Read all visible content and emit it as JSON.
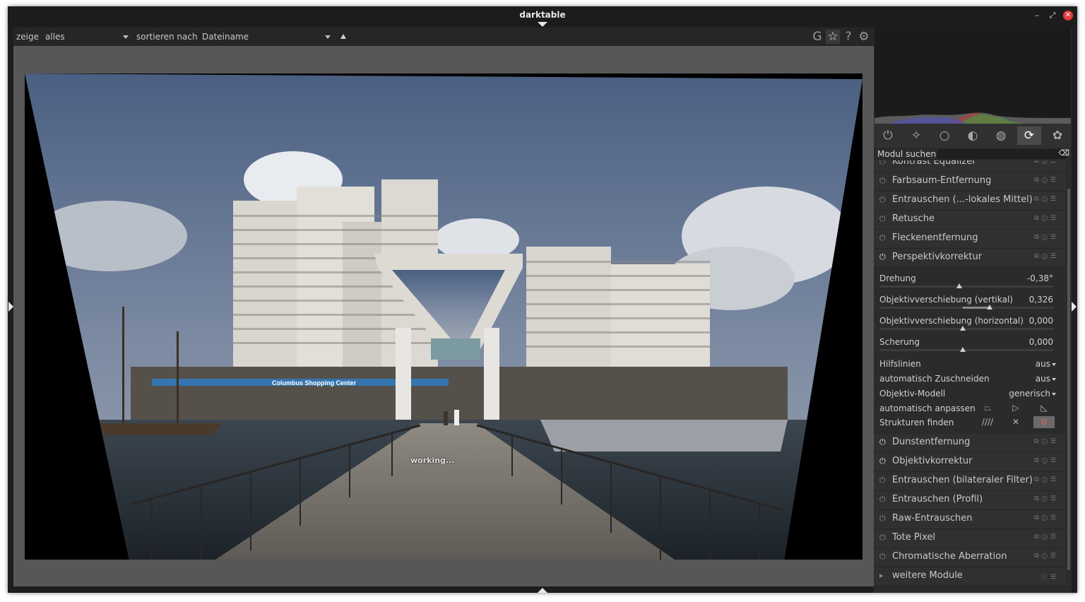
{
  "window": {
    "title": "darktable",
    "controls": [
      "–",
      "⤢",
      "✕"
    ]
  },
  "toolbar": {
    "show_label": "zeige",
    "show_value": "alles",
    "sort_label": "sortieren nach",
    "sort_value": "Dateiname",
    "icons": [
      "G",
      "☆",
      "?",
      "⚙"
    ]
  },
  "center": {
    "status": "working..."
  },
  "photo": {
    "sign_text": "Columbus Shopping Center"
  },
  "panel": {
    "module_groups": [
      "power-icon",
      "star-icon",
      "circle-icon",
      "tone-icon",
      "color-icon",
      "correct-icon",
      "effect-icon"
    ],
    "search_label": "Modul suchen",
    "modules_above": [
      {
        "name": "Kontrast Equalizer",
        "on": false
      },
      {
        "name": "Farbsaum-Entfernung",
        "on": false
      },
      {
        "name": "Entrauschen (...-lokales Mittel)",
        "on": false
      },
      {
        "name": "Retusche",
        "on": false
      },
      {
        "name": "Fleckenentfernung",
        "on": false
      },
      {
        "name": "Perspektivkorrektur",
        "on": true
      }
    ],
    "perspective": {
      "rotation_label": "Drehung",
      "rotation_value": "-0,38°",
      "rotation_pos": 0.47,
      "lens_v_label": "Objektivverschiebung (vertikal)",
      "lens_v_value": "0,326",
      "lens_v_pos": 0.66,
      "lens_h_label": "Objektivverschiebung (horizontal)",
      "lens_h_value": "0,000",
      "lens_h_pos": 0.5,
      "shear_label": "Scherung",
      "shear_value": "0,000",
      "shear_pos": 0.5,
      "guides_label": "Hilfslinien",
      "guides_value": "aus",
      "autocrop_label": "automatisch Zuschneiden",
      "autocrop_value": "aus",
      "lensmodel_label": "Objektiv-Modell",
      "lensmodel_value": "generisch",
      "autofit_label": "automatisch anpassen",
      "structure_label": "Strukturen finden"
    },
    "modules_below": [
      {
        "name": "Dunstentfernung",
        "on": true
      },
      {
        "name": "Objektivkorrektur",
        "on": true
      },
      {
        "name": "Entrauschen (bilateraler Filter)",
        "on": false
      },
      {
        "name": "Entrauschen (Profil)",
        "on": false
      },
      {
        "name": "Raw-Entrauschen",
        "on": false
      },
      {
        "name": "Tote Pixel",
        "on": false
      },
      {
        "name": "Chromatische Aberration",
        "on": false
      }
    ],
    "more_label": "weitere Module"
  }
}
